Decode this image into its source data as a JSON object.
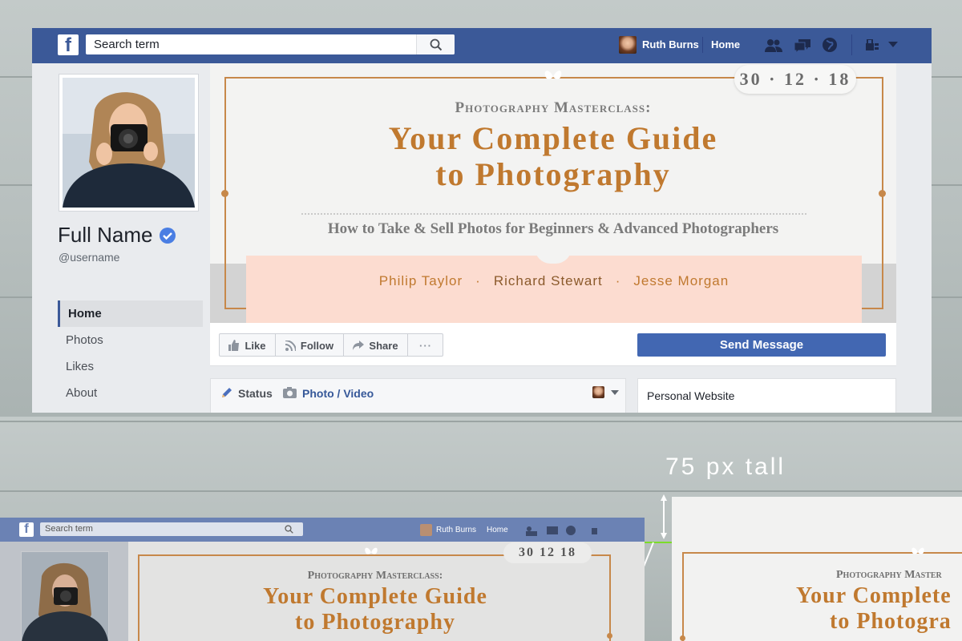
{
  "search": {
    "placeholder": "Search term"
  },
  "nav": {
    "user": "Ruth Burns",
    "home": "Home"
  },
  "profile": {
    "name": "Full Name",
    "username": "@username"
  },
  "menu": [
    "Home",
    "Photos",
    "Likes",
    "About"
  ],
  "cover": {
    "date": "30 · 12 · 18",
    "pretitle": "Photography Masterclass:",
    "title_line1": "Your Complete Guide",
    "title_line2": "to Photography",
    "subtitle": "How to Take & Sell Photos for Beginners & Advanced Photographers",
    "authors": [
      "Philip Taylor",
      "Richard Stewart",
      "Jesse Morgan"
    ],
    "author_sep": "·"
  },
  "actions": {
    "like": "Like",
    "follow": "Follow",
    "share": "Share",
    "more": "···",
    "send": "Send Message"
  },
  "composer": {
    "status": "Status",
    "photo": "Photo / Video"
  },
  "side": {
    "website": "Personal Website"
  },
  "annotation": {
    "label": "75 px tall"
  },
  "mini": {
    "search": "Search term",
    "user": "Ruth Burns",
    "home": "Home",
    "date": "30  12  18",
    "pretitle": "Photography Masterclass:",
    "title_line1": "Your Complete Guide",
    "title_line2": "to Photography",
    "right_pretitle": "Photography Master",
    "right_line1": "Your Complete",
    "right_line2": "to Photogra"
  },
  "colors": {
    "facebook_blue": "#3b5998",
    "gold": "#c0792f",
    "peach": "#fcdcd0",
    "accent_green": "#7cdc2a"
  }
}
